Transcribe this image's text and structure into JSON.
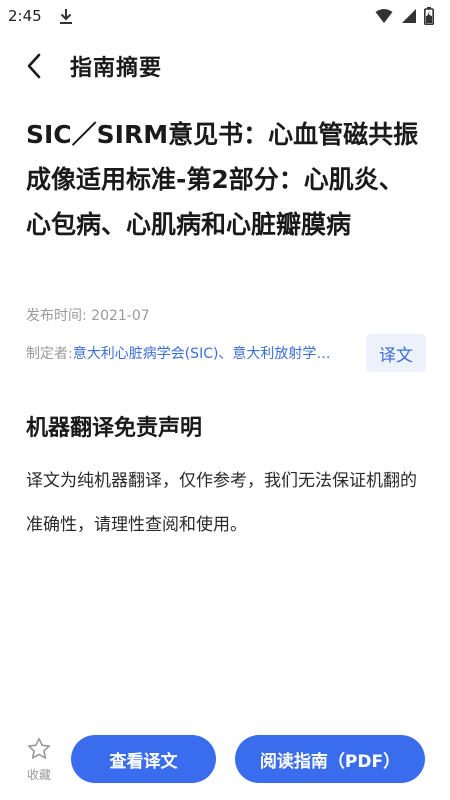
{
  "status_bar": {
    "time": "2:45",
    "icons": [
      "download-icon",
      "wifi-icon",
      "signal-icon",
      "battery-icon"
    ]
  },
  "app_bar": {
    "back_icon": "chevron-left-icon",
    "title": "指南摘要"
  },
  "article": {
    "title": "SIC／SIRM意见书：心血管磁共振成像适用标准-第2部分：心肌炎、心包病、心肌病和心脏瓣膜病",
    "publish_label": "发布时间: ",
    "publish_date": "2021-07",
    "author_label": "制定者:",
    "author_value": "意大利心脏病学会(SIC)、意大利放射学会(SIRM)",
    "translate_button": "译文"
  },
  "disclaimer": {
    "title": "机器翻译免责声明",
    "body": "译文为纯机器翻译，仅作参考，我们无法保证机翻的准确性，请理性查阅和使用。"
  },
  "bottom_bar": {
    "favorite_icon": "star-outline-icon",
    "favorite_label": "收藏",
    "view_translation": "查看译文",
    "read_guide": "阅读指南（PDF）"
  },
  "colors": {
    "accent": "#3a6ded",
    "link": "#3b6fd8",
    "muted_text": "#9a9a9a",
    "chip_bg": "#ecf1fb"
  }
}
